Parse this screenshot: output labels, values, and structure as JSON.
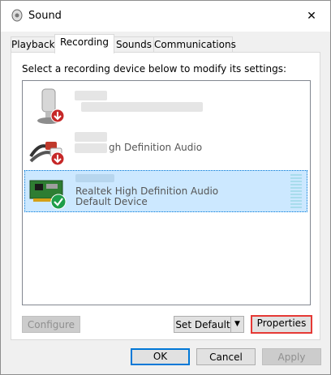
{
  "window": {
    "title": "Sound",
    "close_glyph": "✕"
  },
  "tabs": [
    {
      "label": "Playback",
      "active": false
    },
    {
      "label": "Recording",
      "active": true
    },
    {
      "label": "Sounds",
      "active": false
    },
    {
      "label": "Communications",
      "active": false
    }
  ],
  "instructions": "Select a recording device below to modify its settings:",
  "devices": [
    {
      "name": "",
      "sub": "",
      "icon": "microphone-icon",
      "status_icon": "down-arrow-badge-icon",
      "selected": false
    },
    {
      "name": "gh Definition Audio",
      "sub": "",
      "icon": "rca-line-in-icon",
      "status_icon": "down-arrow-badge-icon",
      "selected": false
    },
    {
      "name": "Realtek High Definition Audio",
      "sub": "Default Device",
      "icon": "sound-card-icon",
      "status_icon": "check-badge-icon",
      "selected": true
    }
  ],
  "buttons": {
    "configure": "Configure",
    "set_default": "Set Default",
    "properties": "Properties",
    "ok": "OK",
    "cancel": "Cancel",
    "apply": "Apply"
  },
  "colors": {
    "selection": "#cce8ff",
    "accent": "#0078d7",
    "highlight": "#e53935",
    "arrow_red": "#c62828",
    "check_green": "#1e9e4a"
  }
}
